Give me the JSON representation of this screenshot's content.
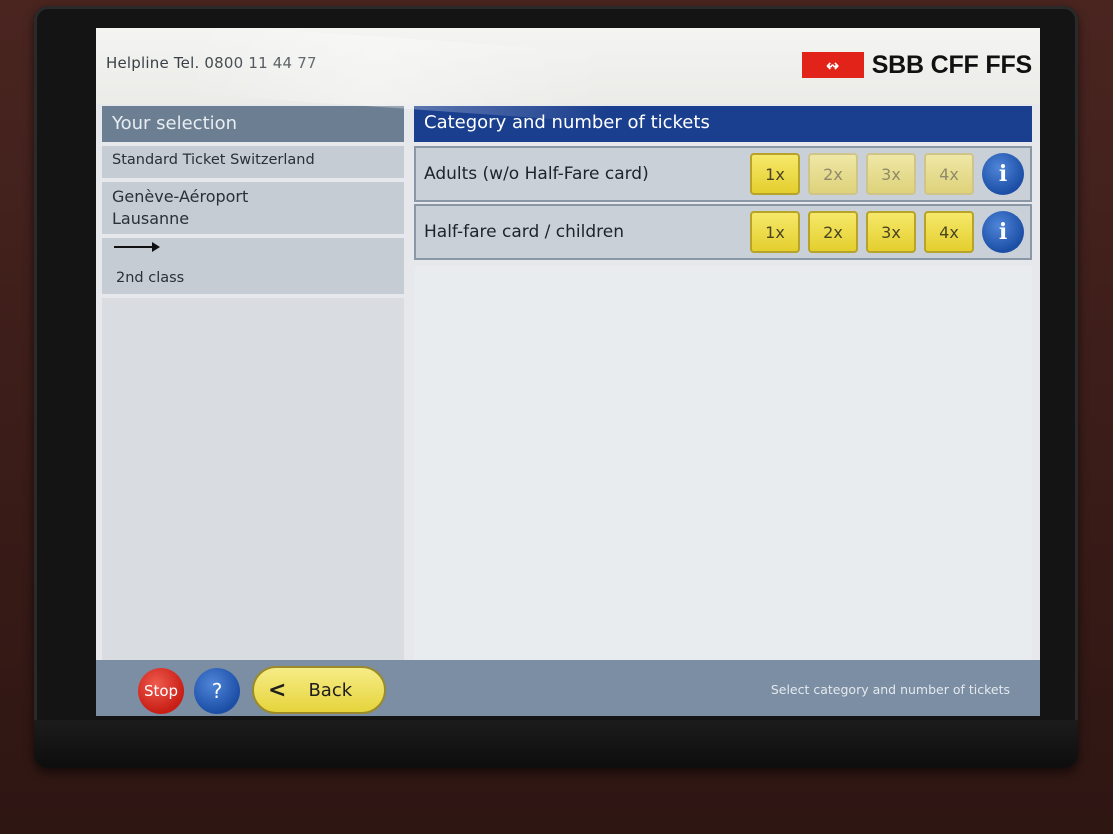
{
  "header": {
    "helpline": "Helpline  Tel. 0800 11 44 77",
    "logo_symbol": "↭",
    "logo_text": "SBB CFF FFS",
    "logo_color": "#e2231a"
  },
  "selection": {
    "title": "Your selection",
    "ticket_type": "Standard Ticket Switzerland",
    "origin": "Genève-Aéroport",
    "destination": "Lausanne",
    "direction_icon": "arrow-right-icon",
    "class": "2nd class"
  },
  "tickets": {
    "title": "Category and number of tickets",
    "rows": [
      {
        "label": "Adults (w/o Half-Fare card)",
        "buttons": [
          "1x",
          "2x",
          "3x",
          "4x"
        ],
        "info": "i"
      },
      {
        "label": "Half-fare card / children",
        "buttons": [
          "1x",
          "2x",
          "3x",
          "4x"
        ],
        "info": "i"
      }
    ]
  },
  "footer": {
    "stop": "Stop",
    "help": "?",
    "back": "Back",
    "status": "Select category and number of tickets"
  },
  "colors": {
    "header_blue": "#1b3f8f",
    "button_yellow": "#e4cf2e",
    "bottom_bar": "#7b8ea3"
  }
}
